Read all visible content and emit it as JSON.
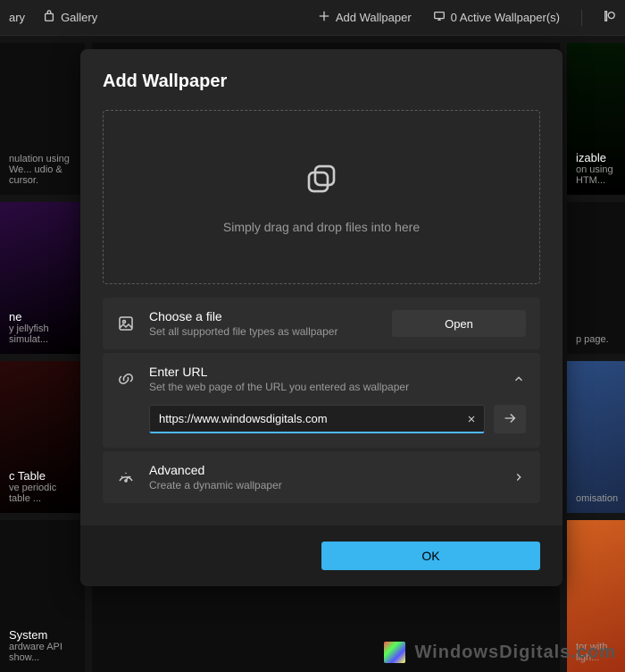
{
  "topbar": {
    "library_label": "ary",
    "gallery_label": "Gallery",
    "add_wallpaper_label": "Add Wallpaper",
    "active_wallpapers_label": "0 Active Wallpaper(s)"
  },
  "modal": {
    "title": "Add Wallpaper",
    "dropzone_text": "Simply drag and drop files into here",
    "choose_file": {
      "title": "Choose a file",
      "subtitle": "Set all supported file types as wallpaper",
      "button": "Open"
    },
    "enter_url": {
      "title": "Enter URL",
      "subtitle": "Set the web page of the URL you entered as wallpaper",
      "value": "https://www.windowsdigitals.com",
      "placeholder": ""
    },
    "advanced": {
      "title": "Advanced",
      "subtitle": "Create a dynamic wallpaper"
    },
    "ok_button": "OK"
  },
  "tiles": [
    {
      "title": "",
      "sub": "nulation using We...\nudio & cursor."
    },
    {
      "title": "",
      "sub": ""
    },
    {
      "title": "izable",
      "sub": "on using HTM..."
    },
    {
      "title": "ne",
      "sub": "y jellyfish simulat..."
    },
    {
      "title": "",
      "sub": ""
    },
    {
      "title": "",
      "sub": "p page."
    },
    {
      "title": "c Table",
      "sub": "ve periodic table ..."
    },
    {
      "title": "",
      "sub": ""
    },
    {
      "title": "",
      "sub": "omisation"
    },
    {
      "title": "System",
      "sub": "ardware API show..."
    },
    {
      "title": "",
      "sub": ""
    },
    {
      "title": "",
      "sub": "tor with ligh..."
    }
  ],
  "watermark": "WindowsDigitals.com"
}
